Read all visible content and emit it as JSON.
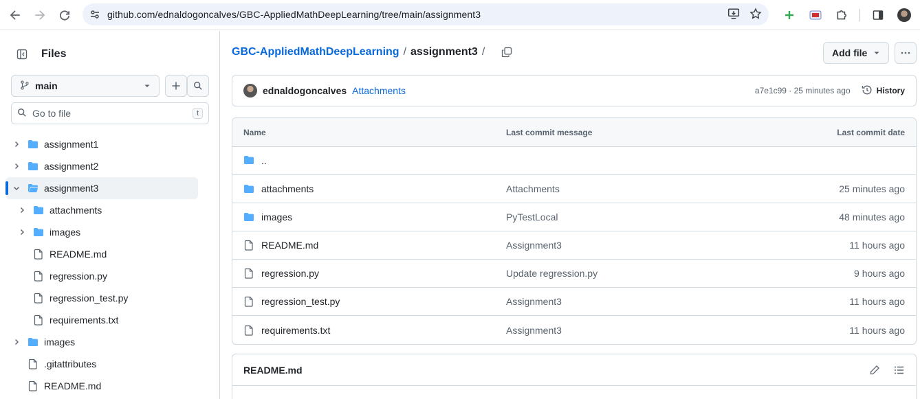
{
  "browser": {
    "url": "github.com/ednaldogoncalves/GBC-AppliedMathDeepLearning/tree/main/assignment3"
  },
  "sidebar": {
    "title": "Files",
    "branch": "main",
    "search_placeholder": "Go to file",
    "search_shortcut": "t",
    "tree": [
      {
        "label": "assignment1",
        "type": "folder",
        "expanded": false,
        "depth": 0
      },
      {
        "label": "assignment2",
        "type": "folder",
        "expanded": false,
        "depth": 0
      },
      {
        "label": "assignment3",
        "type": "folder",
        "expanded": true,
        "depth": 0,
        "active": true
      },
      {
        "label": "attachments",
        "type": "folder",
        "expanded": false,
        "depth": 1
      },
      {
        "label": "images",
        "type": "folder",
        "expanded": false,
        "depth": 1
      },
      {
        "label": "README.md",
        "type": "file",
        "depth": 1
      },
      {
        "label": "regression.py",
        "type": "file",
        "depth": 1
      },
      {
        "label": "regression_test.py",
        "type": "file",
        "depth": 1
      },
      {
        "label": "requirements.txt",
        "type": "file",
        "depth": 1
      },
      {
        "label": "images",
        "type": "folder",
        "expanded": false,
        "depth": 0
      },
      {
        "label": ".gitattributes",
        "type": "file",
        "depth": 0
      },
      {
        "label": "README.md",
        "type": "file",
        "depth": 0
      }
    ]
  },
  "main": {
    "breadcrumb": {
      "repo": "GBC-AppliedMathDeepLearning",
      "sep1": "/",
      "current": "assignment3",
      "sep2": "/"
    },
    "add_file_label": "Add file",
    "commit": {
      "author": "ednaldogoncalves",
      "message": "Attachments",
      "sha_time": "a7e1c99 · 25 minutes ago",
      "history_label": "History"
    },
    "table": {
      "headers": {
        "name": "Name",
        "message": "Last commit message",
        "date": "Last commit date"
      },
      "parent": "..",
      "rows": [
        {
          "name": "attachments",
          "type": "folder",
          "message": "Attachments",
          "date": "25 minutes ago"
        },
        {
          "name": "images",
          "type": "folder",
          "message": "PyTestLocal",
          "date": "48 minutes ago"
        },
        {
          "name": "README.md",
          "type": "file",
          "message": "Assignment3",
          "date": "11 hours ago"
        },
        {
          "name": "regression.py",
          "type": "file",
          "message": "Update regression.py",
          "date": "9 hours ago"
        },
        {
          "name": "regression_test.py",
          "type": "file",
          "message": "Assignment3",
          "date": "11 hours ago"
        },
        {
          "name": "requirements.txt",
          "type": "file",
          "message": "Assignment3",
          "date": "11 hours ago"
        }
      ]
    },
    "readme_title": "README.md"
  },
  "colors": {
    "accent": "#0969da",
    "folder": "#54aeff",
    "border": "#d1d9e0",
    "muted": "#59636e"
  }
}
